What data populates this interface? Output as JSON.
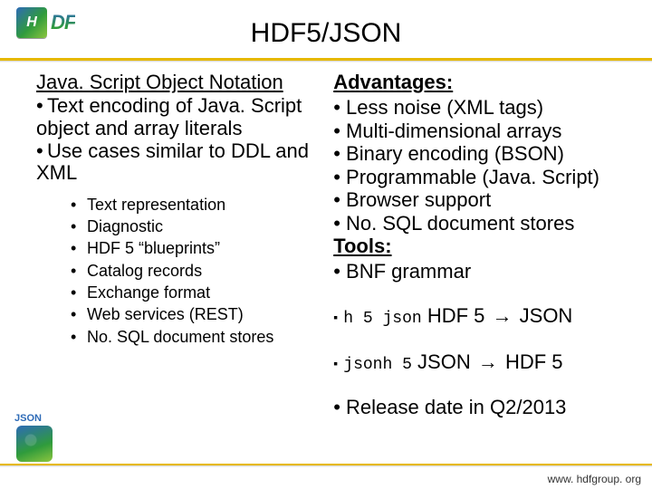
{
  "logo": {
    "box_text": "H",
    "side_text": "DF"
  },
  "title": "HDF5/JSON",
  "left": {
    "heading": "Java. Script Object Notation",
    "bullets": [
      "Text encoding of Java. Script object and array literals",
      "Use cases similar to DDL and XML"
    ],
    "sub": [
      "Text representation",
      "Diagnostic",
      "HDF 5 “blueprints”",
      "Catalog records",
      "Exchange format",
      "Web services (REST)",
      "No. SQL document stores"
    ]
  },
  "right": {
    "adv_heading": "Advantages:",
    "adv": [
      "Less noise (XML tags)",
      "Multi-dimensional arrays",
      "Binary encoding (BSON)",
      "Programmable (Java. Script)",
      "Browser support",
      "No. SQL document stores"
    ],
    "tools_heading": "Tools:",
    "tools_bnf": "BNF grammar",
    "tool1_cmd": "h 5 json",
    "tool1_from": "HDF 5",
    "tool1_to": "JSON",
    "tool2_cmd": "jsonh 5",
    "tool2_from": "JSON",
    "tool2_to": "HDF 5",
    "release": "Release date in Q2/2013"
  },
  "json_badge_label": "JSON",
  "footer": "www. hdfgroup. org"
}
